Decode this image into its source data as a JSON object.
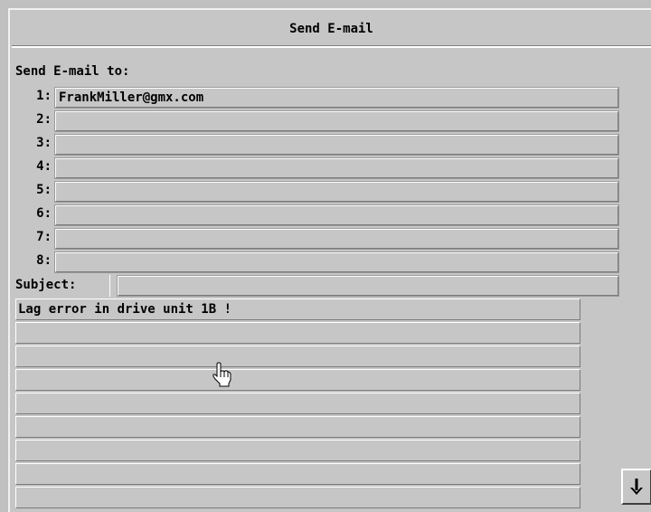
{
  "window": {
    "title": "Send E-mail"
  },
  "recipients": {
    "label": "Send E-mail to:",
    "rows": [
      {
        "num": "1:",
        "value": "FrankMiller@gmx.com"
      },
      {
        "num": "2:",
        "value": ""
      },
      {
        "num": "3:",
        "value": ""
      },
      {
        "num": "4:",
        "value": ""
      },
      {
        "num": "5:",
        "value": ""
      },
      {
        "num": "6:",
        "value": ""
      },
      {
        "num": "7:",
        "value": ""
      },
      {
        "num": "8:",
        "value": ""
      }
    ]
  },
  "subject": {
    "label": "Subject:",
    "value": ""
  },
  "message": {
    "lines": [
      "Lag error in drive unit 1B !",
      "",
      "",
      "",
      "",
      "",
      "",
      "",
      ""
    ]
  },
  "icons": {
    "scroll": "arrow-down-icon",
    "pointer": "hand-cursor-icon"
  },
  "colors": {
    "background": "#c6c6c6",
    "text": "#000000"
  }
}
